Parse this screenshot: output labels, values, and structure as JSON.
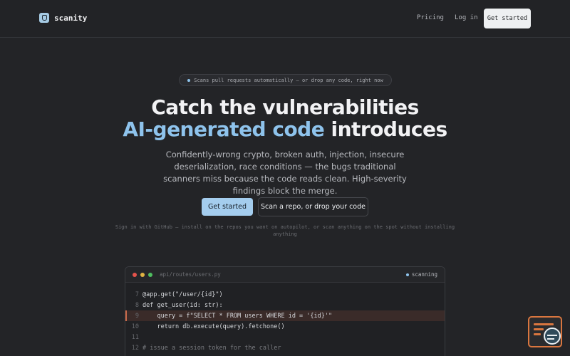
{
  "nav": {
    "brand": "scanity",
    "links": [
      "Pricing",
      "Log in"
    ],
    "cta": "Get started"
  },
  "hero": {
    "pill": "Scans pull requests automatically — or drop any code, right now",
    "title_line1": "Catch the vulnerabilities",
    "title_accent": "AI-generated code",
    "title_rest": " introduces",
    "subtitle": "Confidently-wrong crypto, broken auth, injection, insecure deserialization, race conditions — the bugs traditional scanners miss because the code reads clean. High-severity findings block the merge.",
    "primary_cta": "Get started",
    "secondary_cta": "Scan a repo, or drop your code",
    "fineprint": "Sign in with GitHub — install on the repos you want on autopilot, or scan anything on the spot without installing anything"
  },
  "code_window": {
    "path": "api/routes/users.py",
    "status": "scanning",
    "lines": [
      {
        "n": "7",
        "text": "@app.get(\"/user/{id}\")"
      },
      {
        "n": "8",
        "text": "def get_user(id: str):"
      },
      {
        "n": "9",
        "text": "    query = f\"SELECT * FROM users WHERE id = '{id}'\""
      },
      {
        "n": "10",
        "text": "    return db.execute(query).fetchone()"
      },
      {
        "n": "11",
        "text": ""
      },
      {
        "n": "12",
        "text": "# issue a session token for the caller"
      }
    ]
  },
  "colors": {
    "accent": "#8ec3ec",
    "background": "#232427",
    "highlight_line": "#3a2b29"
  }
}
